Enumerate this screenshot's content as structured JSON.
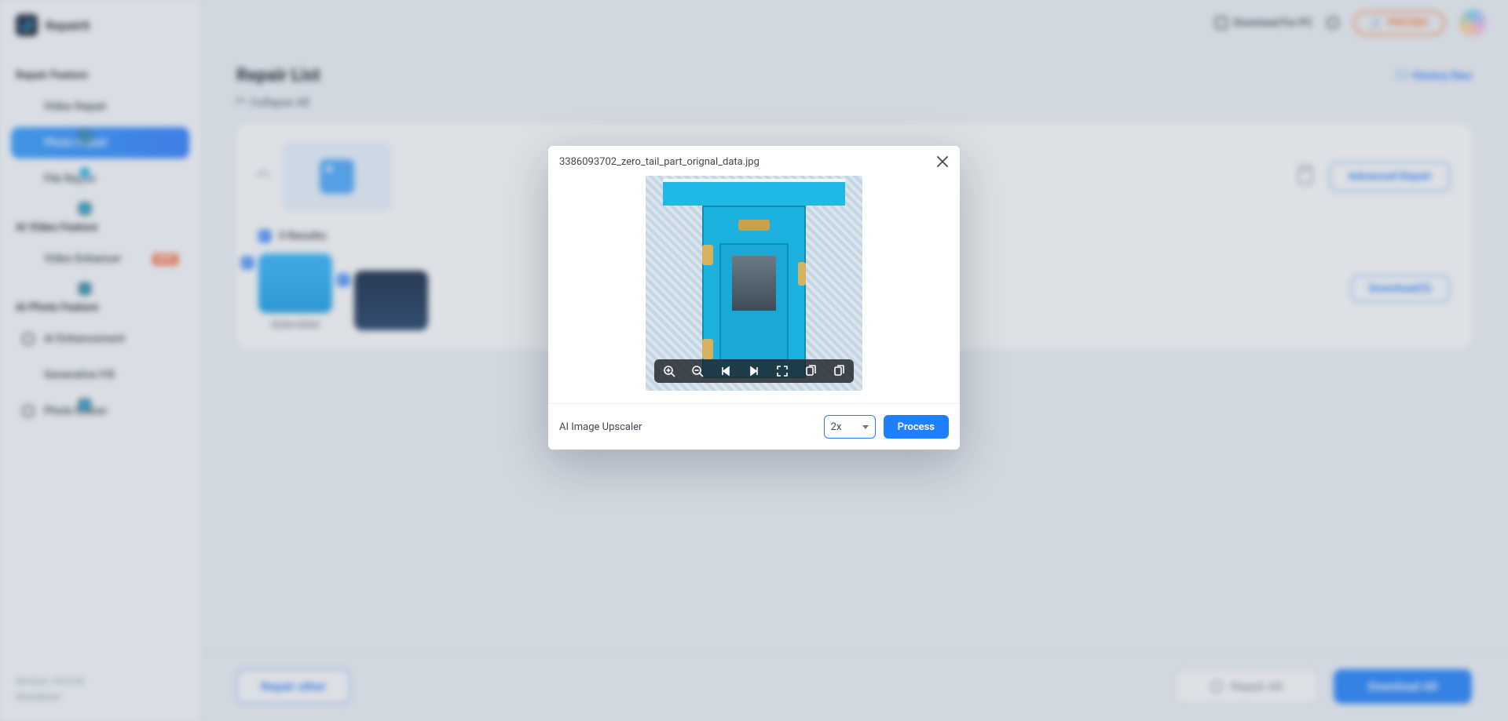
{
  "brand": {
    "name": "Repairit"
  },
  "topbar": {
    "download_pc": "Download For PC",
    "pricing": "PRICING"
  },
  "sidebar": {
    "sections": {
      "repair": "Repair Feature",
      "ai_video": "AI Video Feature",
      "ai_photo": "AI Photo Feature"
    },
    "items": {
      "video_repair": "Video Repair",
      "photo_repair": "Photo Repair",
      "file_repair": "File Repair",
      "video_enhancer": "Video Enhancer",
      "ai_enhancement": "AI Enhancement",
      "generative_fill": "Generative Fill",
      "photo_eraser": "Photo Eraser"
    },
    "badge_new": "NEW",
    "footer": {
      "version": "Version: V5.0.32",
      "disclaimer": "Disclaimer:"
    }
  },
  "page": {
    "title": "Repair List",
    "history": "History files",
    "collapse": "Collapse All"
  },
  "card": {
    "advanced": "Advanced Repair",
    "results_label": "5 Results:",
    "thumb1_dim": "8256×5504",
    "download_n": "Download(5)"
  },
  "bottom": {
    "repair_other": "Repair other",
    "repair_all": "Repair All",
    "download_all": "Download All"
  },
  "modal": {
    "filename": "3386093702_zero_tail_part_orignal_data.jpg",
    "upscaler_label": "AI Image Upscaler",
    "scale": "2x",
    "process": "Process",
    "toolbar": {
      "zoom_in": "zoom-in",
      "zoom_out": "zoom-out",
      "prev": "previous",
      "next": "next",
      "fullscreen": "fullscreen",
      "copy": "copy",
      "copy2": "copy"
    }
  }
}
